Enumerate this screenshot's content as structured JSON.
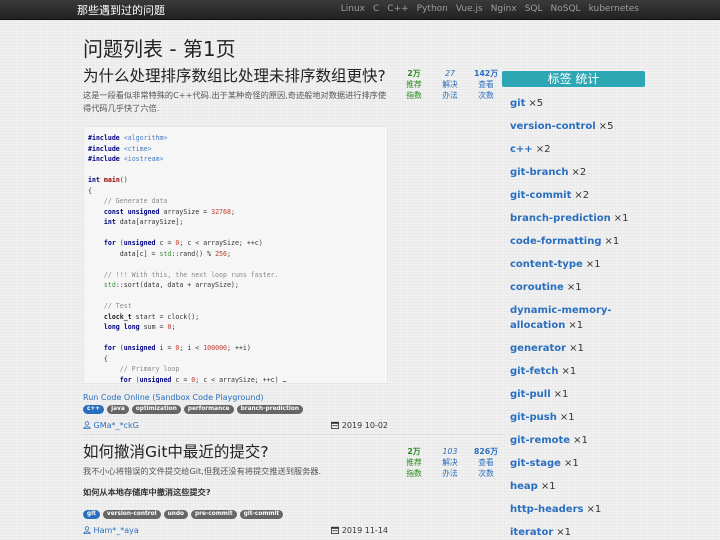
{
  "navbar": {
    "brand": "那些遇到过的问题",
    "links": [
      "Linux",
      "C",
      "C++",
      "Python",
      "Vue.js",
      "Nginx",
      "SQL",
      "NoSQL",
      "kubernetes"
    ]
  },
  "page_title": "问题列表 - 第1页",
  "questions": [
    {
      "title": "为什么处理排序数组比处理未排序数组更快?",
      "excerpt": "这是一段看似非常特殊的C++代码.出于某种奇怪的原因,奇迹般地对数据进行排序使得代码几乎快了六倍.",
      "stats": {
        "votes": "2万",
        "votes_label": "推荐指数",
        "answers": "27",
        "answers_label": "解决办法",
        "views": "142万",
        "views_label": "查看次数"
      },
      "code": "#include <algorithm>\n#include <ctime>\n#include <iostream>\n\nint main()\n{\n    // Generate data\n    const unsigned arraySize = 32768;\n    int data[arraySize];\n\n    for (unsigned c = 0; c < arraySize; ++c)\n        data[c] = std::rand() % 256;\n\n    // !!! With this, the next loop runs faster.\n    std::sort(data, data + arraySize);\n\n    // Test\n    clock_t start = clock();\n    long long sum = 0;\n\n    for (unsigned i = 0; i < 100000; ++i)\n    {\n        // Primary loop\n        for (unsigned c = 0; c < arraySize; ++c) …",
      "link": "Run Code Online (Sandbox Code Playground)",
      "tags": [
        "c++",
        "java",
        "optimization",
        "performance",
        "branch-prediction"
      ],
      "author": "GMa*_*ckG",
      "date": "2019 10-02"
    },
    {
      "title": "如何撤消Git中最近的提交?",
      "excerpt": "我不小心将错误的文件提交给Git,但我还没有将提交推送到服务器.",
      "subheading": "如何从本地存储库中撤消这些提交?",
      "stats": {
        "votes": "2万",
        "votes_label": "推荐指数",
        "answers": "103",
        "answers_label": "解决办法",
        "views": "826万",
        "views_label": "查看次数"
      },
      "tags": [
        "git",
        "version-control",
        "undo",
        "pre-commit",
        "git-commit"
      ],
      "author": "Ham*_*aya",
      "date": "2019 11-14"
    }
  ],
  "sidebar": {
    "heading": "标签 统计",
    "tags": [
      {
        "name": "git",
        "count": "×5"
      },
      {
        "name": "version-control",
        "count": "×5"
      },
      {
        "name": "c++",
        "count": "×2"
      },
      {
        "name": "git-branch",
        "count": "×2"
      },
      {
        "name": "git-commit",
        "count": "×2"
      },
      {
        "name": "branch-prediction",
        "count": "×1"
      },
      {
        "name": "code-formatting",
        "count": "×1"
      },
      {
        "name": "content-type",
        "count": "×1"
      },
      {
        "name": "coroutine",
        "count": "×1"
      },
      {
        "name": "dynamic-memory-allocation",
        "count": "×1"
      },
      {
        "name": "generator",
        "count": "×1"
      },
      {
        "name": "git-fetch",
        "count": "×1"
      },
      {
        "name": "git-pull",
        "count": "×1"
      },
      {
        "name": "git-push",
        "count": "×1"
      },
      {
        "name": "git-remote",
        "count": "×1"
      },
      {
        "name": "git-stage",
        "count": "×1"
      },
      {
        "name": "heap",
        "count": "×1"
      },
      {
        "name": "http-headers",
        "count": "×1"
      },
      {
        "name": "iterator",
        "count": "×1"
      }
    ]
  },
  "colors": {
    "navbar": "#222222",
    "link": "#2a6fbf",
    "votes": "#2a8b1f",
    "sidebar_heading": "#2da7b3"
  },
  "icons": {
    "author": "user-icon",
    "date": "calendar-icon"
  }
}
